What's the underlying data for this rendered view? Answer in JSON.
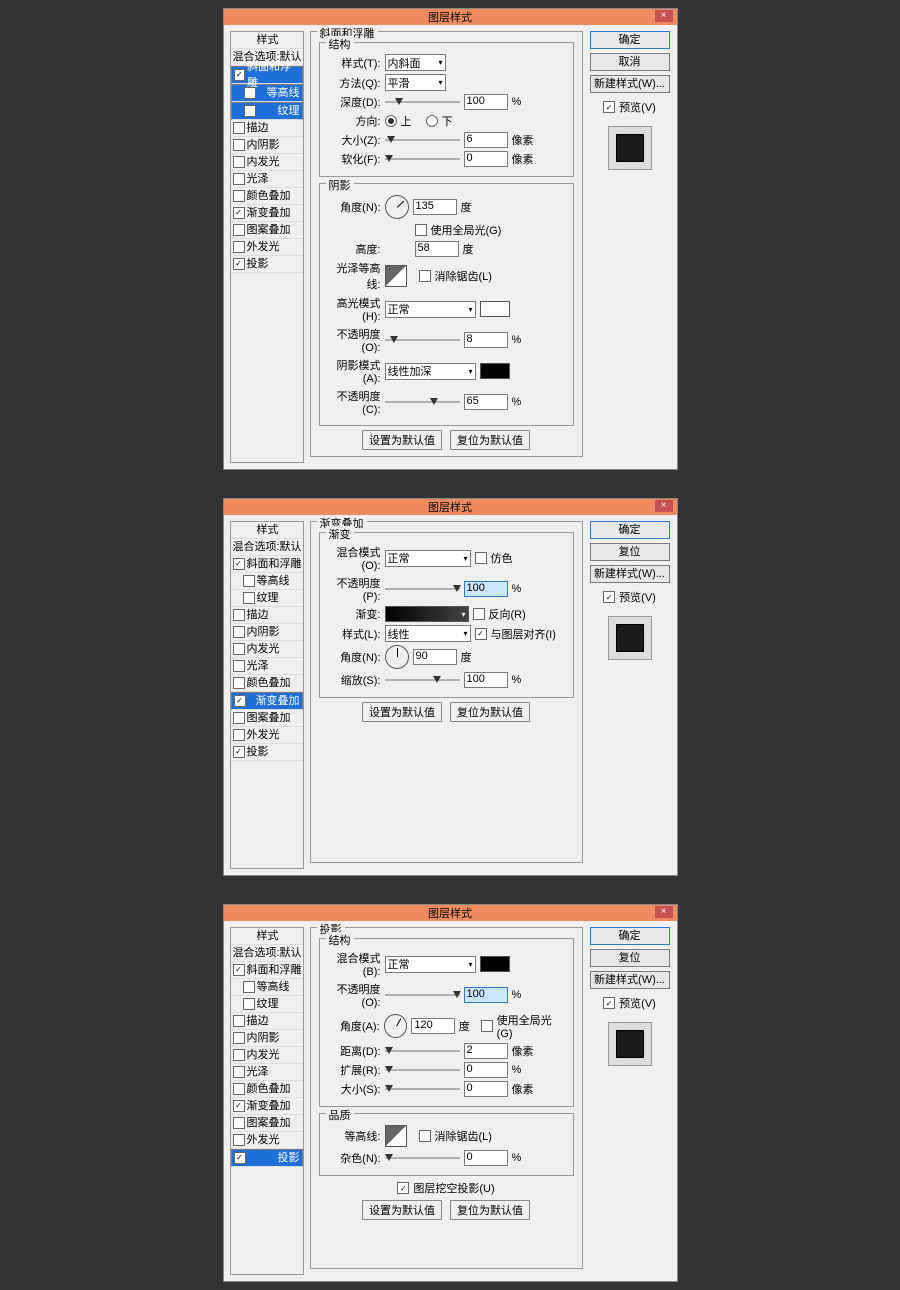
{
  "dlg_title": "图层样式",
  "close": "×",
  "styles_title": "样式",
  "blend_opts": "混合选项:默认",
  "s_bevel": "斜面和浮雕",
  "s_contour": "等高线",
  "s_texture": "纹理",
  "s_stroke": "描边",
  "s_inner_shadow": "内阴影",
  "s_inner_glow": "内发光",
  "s_satin": "光泽",
  "s_color_overlay": "颜色叠加",
  "s_grad_overlay": "渐变叠加",
  "s_pattern_overlay": "图案叠加",
  "s_outer_glow": "外发光",
  "s_drop_shadow": "投影",
  "btn_ok": "确定",
  "btn_cancel": "取消",
  "btn_reset": "复位",
  "btn_newstyle": "新建样式(W)...",
  "cb_preview": "预览(V)",
  "btn_default": "设置为默认值",
  "btn_restore": "复位为默认值",
  "p1": {
    "title": "斜面和浮雕",
    "g1": "结构",
    "style_l": "样式(T):",
    "style_v": "内斜面",
    "tech_l": "方法(Q):",
    "tech_v": "平滑",
    "depth_l": "深度(D):",
    "depth_v": "100",
    "pct": "%",
    "dir_l": "方向:",
    "up": "上",
    "down": "下",
    "size_l": "大小(Z):",
    "size_v": "6",
    "px": "像素",
    "soft_l": "软化(F):",
    "soft_v": "0",
    "g2": "阴影",
    "angle_l": "角度(N):",
    "angle_v": "135",
    "deg": "度",
    "global": "使用全局光(G)",
    "alt_l": "高度:",
    "alt_v": "58",
    "gloss_l": "光泽等高线:",
    "aa": "消除锯齿(L)",
    "hmode_l": "高光模式(H):",
    "hmode_v": "正常",
    "hopac_l": "不透明度(O):",
    "hopac_v": "8",
    "smode_l": "阴影模式(A):",
    "smode_v": "线性加深",
    "sopac_l": "不透明度(C):",
    "sopac_v": "65"
  },
  "p2": {
    "title": "渐变叠加",
    "g1": "渐变",
    "mode_l": "混合模式(O):",
    "mode_v": "正常",
    "dither": "仿色",
    "opac_l": "不透明度(P):",
    "opac_v": "100",
    "pct": "%",
    "grad_l": "渐变:",
    "reverse": "反向(R)",
    "style_l": "样式(L):",
    "style_v": "线性",
    "align": "与图层对齐(I)",
    "angle_l": "角度(N):",
    "angle_v": "90",
    "deg": "度",
    "scale_l": "缩放(S):",
    "scale_v": "100"
  },
  "p3": {
    "title": "投影",
    "g1": "结构",
    "mode_l": "混合模式(B):",
    "mode_v": "正常",
    "opac_l": "不透明度(O):",
    "opac_v": "100",
    "pct": "%",
    "angle_l": "角度(A):",
    "angle_v": "120",
    "deg": "度",
    "global": "使用全局光(G)",
    "dist_l": "距离(D):",
    "dist_v": "2",
    "px": "像素",
    "spread_l": "扩展(R):",
    "spread_v": "0",
    "size_l": "大小(S):",
    "size_v": "0",
    "g2": "品质",
    "contour_l": "等高线:",
    "aa": "消除锯齿(L)",
    "noise_l": "杂色(N):",
    "noise_v": "0",
    "knockout": "图层挖空投影(U)"
  }
}
